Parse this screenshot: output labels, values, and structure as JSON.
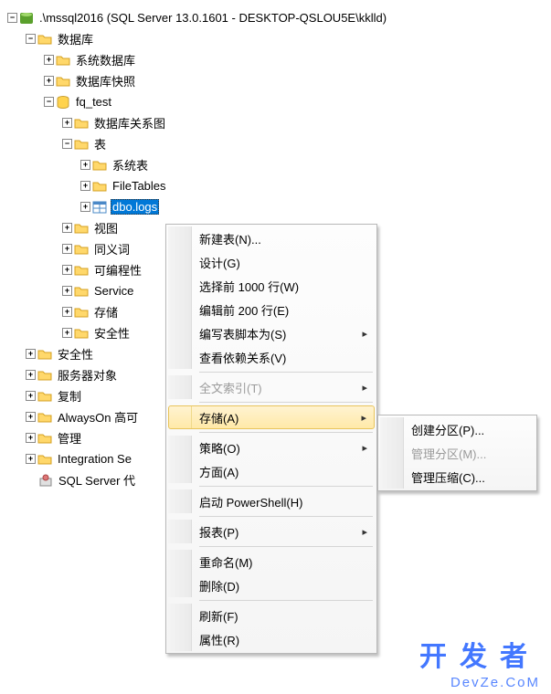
{
  "root": {
    "label": ".\\mssql2016 (SQL Server 13.0.1601 - DESKTOP-QSLOU5E\\kklld)"
  },
  "tree": {
    "databases": "数据库",
    "sysdb": "系统数据库",
    "snapshot": "数据库快照",
    "fqtest": "fq_test",
    "diagram": "数据库关系图",
    "tables": "表",
    "systables": "系统表",
    "filetables": "FileTables",
    "dbo_logs": "dbo.logs",
    "views": "视图",
    "synonyms": "同义词",
    "programmability": "可编程性",
    "service": "Service",
    "storage": "存储",
    "dbsecurity": "安全性",
    "security": "安全性",
    "serverobj": "服务器对象",
    "replication": "复制",
    "alwayson": "AlwaysOn 高可",
    "management": "管理",
    "integration": "Integration Se",
    "agent": "SQL Server 代"
  },
  "menu": {
    "new_table": "新建表(N)...",
    "design": "设计(G)",
    "select1000": "选择前 1000 行(W)",
    "edit200": "编辑前 200 行(E)",
    "script": "编写表脚本为(S)",
    "view_deps": "查看依赖关系(V)",
    "fulltext": "全文索引(T)",
    "storage": "存储(A)",
    "policies": "策略(O)",
    "facets": "方面(A)",
    "powershell": "启动 PowerShell(H)",
    "reports": "报表(P)",
    "rename": "重命名(M)",
    "delete": "删除(D)",
    "refresh": "刷新(F)",
    "properties": "属性(R)"
  },
  "submenu": {
    "create_partition": "创建分区(P)...",
    "manage_partition": "管理分区(M)...",
    "manage_compression": "管理压缩(C)..."
  },
  "wm": {
    "a": "开发者",
    "b": "DevZe.CoM"
  }
}
